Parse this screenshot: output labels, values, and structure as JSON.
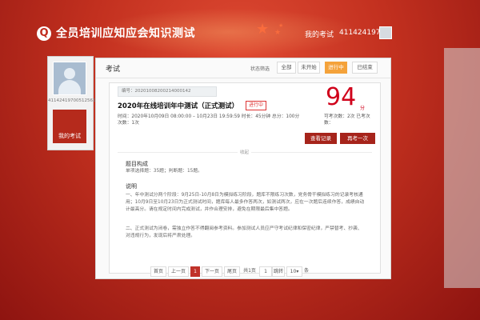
{
  "header": {
    "title": "全员培训应知应会知识测试",
    "my_exam": "我的考试",
    "user_id": "4114241970..."
  },
  "sidebar": {
    "user_id": "411424197005125612",
    "my_exam_label": "我的考试"
  },
  "panel": {
    "title": "考试",
    "status_filter_label": "状态筛选",
    "filters": [
      "全部",
      "未开始",
      "进行中",
      "已结束"
    ],
    "active_filter": "进行中"
  },
  "exam": {
    "id_label": "编号：20201008200214000142",
    "name": "2020年在线培训年中测试（正式测试）",
    "status_tag": "进行中",
    "score": "94",
    "score_unit": "分",
    "time_line": "时间：2020年10月09日 08:00:00 – 10月23日 19:59:59  时长：45分钟  总分：100分",
    "attempts_line": "次数：1次",
    "right_info": "可考次数：2次  已考次数：",
    "btn_view": "查看记录",
    "btn_retry": "再考一次",
    "collapse_label": "收起",
    "structure_heading": "题目构成",
    "structure_text": "单项选择题：35题；判断题：15题。",
    "desc_heading": "说明",
    "desc_1": "一、年中测试分两个阶段：9月25日-10月8日为模拟练习阶段，题库不限练习次数，党务骨干模拟练习的记录考核通用；10月9日至10月23日为正式测试时间，题库每人最多作答两次，如测试两次，应在一次题后连续作答，成绩自动计最高分。请在规定时间内完成测试，并作合理安排，避免在期限最后集中答题。",
    "desc_2": "二、正式测试为闭卷，需独立作答不得翻阅参考资料。参加测试人员应严守考试纪律和保密纪律，严禁替考、抄袭、对违规行为，发现后将严肃处理。"
  },
  "pager": {
    "first": "首页",
    "prev": "上一页",
    "current": "1",
    "next": "下一页",
    "last": "尾页",
    "total": "共1页",
    "goto_value": "1",
    "jump": "跳转",
    "per_page": "10",
    "per_page_unit": "条"
  },
  "colors": {
    "brand_red": "#b7221b",
    "score_red": "#d0021b",
    "active_orange": "#f4a23a"
  }
}
